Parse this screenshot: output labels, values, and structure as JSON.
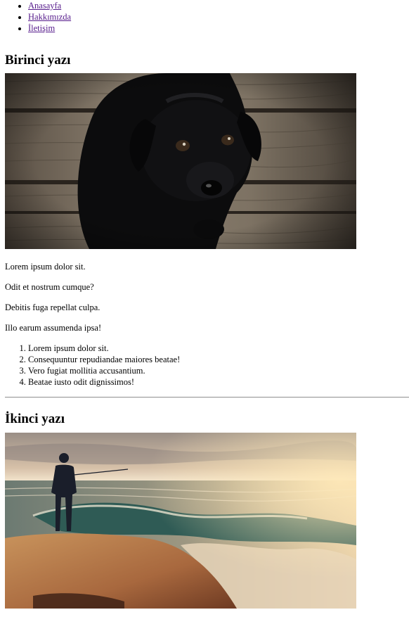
{
  "nav": {
    "items": [
      {
        "label": "Anasayfa"
      },
      {
        "label": "Hakkımızda"
      },
      {
        "label": "İletişim"
      }
    ]
  },
  "post1": {
    "title": "Birinci yazı",
    "image_alt": "Black labrador puppy sitting on wooden planks",
    "paragraphs": [
      "Lorem ipsum dolor sit.",
      "Odit et nostrum cumque?",
      "Debitis fuga repellat culpa.",
      "Illo earum assumenda ipsa!"
    ],
    "list": [
      "Lorem ipsum dolor sit.",
      "Consequuntur repudiandae maiores beatae!",
      "Vero fugiat mollitia accusantium.",
      "Beatae iusto odit dignissimos!"
    ]
  },
  "post2": {
    "title": "İkinci yazı",
    "image_alt": "Man fishing on rocky shore at sunset with waves"
  },
  "colors": {
    "link_visited": "#551a8b",
    "divider": "#9a9a9a"
  }
}
